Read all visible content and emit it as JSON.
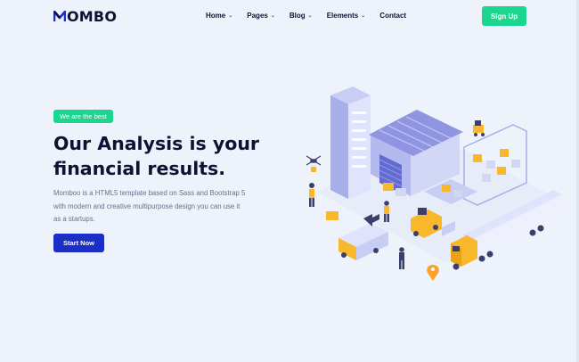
{
  "brand": {
    "name": "OMBO",
    "logo_icon": "m-logo-icon",
    "accent": "#1b2fc6"
  },
  "nav": {
    "items": [
      {
        "label": "Home",
        "has_dropdown": true
      },
      {
        "label": "Pages",
        "has_dropdown": true
      },
      {
        "label": "Blog",
        "has_dropdown": true
      },
      {
        "label": "Elements",
        "has_dropdown": true
      },
      {
        "label": "Contact",
        "has_dropdown": false
      }
    ],
    "signup_label": "Sign Up"
  },
  "hero": {
    "badge": "We are the best",
    "title_line1": "Our Analysis is your",
    "title_line2": "financial results.",
    "desc_line1": "Momboo is a HTML5 template based on Sass and Bootstrap 5",
    "desc_line2": "with modern and creative multipurpose design you can use it",
    "desc_line3": "as a startups.",
    "cta_label": "Start Now"
  },
  "colors": {
    "background": "#eef3fb",
    "green": "#1bd68e",
    "navy": "#0e1133",
    "blue": "#1b2fc6",
    "yellow": "#f9b72b"
  },
  "illustration": {
    "icon": "warehouse-logistics-illustration"
  }
}
